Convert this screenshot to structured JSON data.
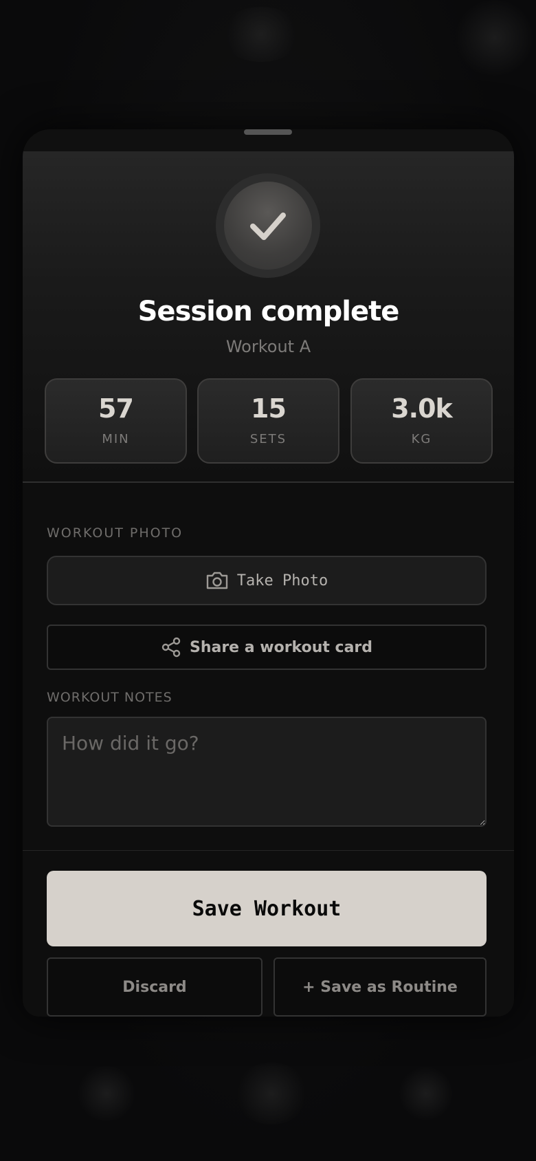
{
  "summary": {
    "title": "Session complete",
    "subtitle": "Workout A",
    "check_icon": "checkmark-icon"
  },
  "stats": [
    {
      "value": "57",
      "label": "MIN"
    },
    {
      "value": "15",
      "label": "SETS"
    },
    {
      "value": "3.0k",
      "label": "KG"
    }
  ],
  "photo": {
    "section_label": "WORKOUT PHOTO",
    "take_photo_label": "Take Photo",
    "camera_icon": "camera-icon",
    "share_label": "Share a workout card",
    "share_icon": "share-icon"
  },
  "notes": {
    "section_label": "WORKOUT NOTES",
    "placeholder": "How did it go?",
    "value": ""
  },
  "actions": {
    "save_label": "Save Workout",
    "discard_label": "Discard",
    "save_routine_label": "+ Save as Routine"
  },
  "colors": {
    "background": "#0a0a0b",
    "accent": "#d6d1cb",
    "text_primary": "#ffffff",
    "text_muted": "#7d7b79"
  }
}
